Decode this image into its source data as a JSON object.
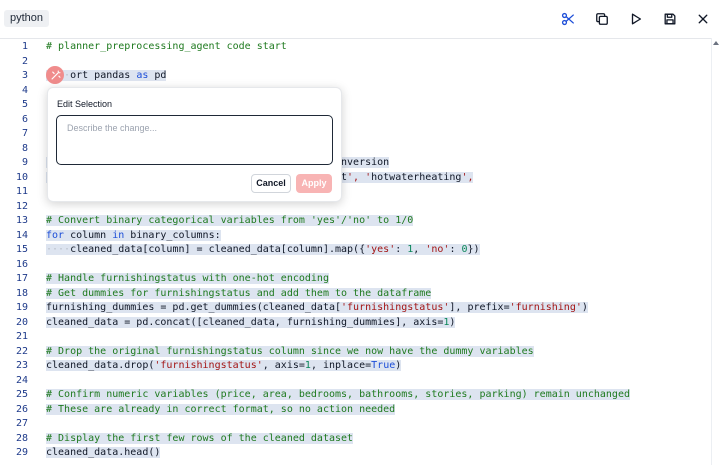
{
  "toolbar": {
    "language": "python",
    "icons": [
      "scissors-icon",
      "copy-icon",
      "play-icon",
      "save-icon",
      "close-icon"
    ]
  },
  "colors": {
    "comment": "#1f7a1f",
    "keyword": "#1d4ed8",
    "string": "#a31515",
    "number": "#098658",
    "line_number": "#1e3a8a",
    "selection": "#dde4f0",
    "ai_button": "#f08c8c",
    "apply_button": "#f8b4b4"
  },
  "editor": {
    "lines": [
      {
        "n": "1",
        "text": "# planner_preprocessing_agent code start"
      },
      {
        "n": "2",
        "text": ""
      },
      {
        "n": "3",
        "text": "    ort pandas as pd"
      },
      {
        "n": "4",
        "text": ""
      },
      {
        "n": "5",
        "text": ""
      },
      {
        "n": "6",
        "text": ""
      },
      {
        "n": "7",
        "text": ""
      },
      {
        "n": "8",
        "text": ""
      },
      {
        "n": "9",
        "text": "                                                onversion"
      },
      {
        "n": "10",
        "text": "                                                nt', 'hotwaterheating',"
      },
      {
        "n": "11",
        "text": ""
      },
      {
        "n": "12",
        "text": ""
      },
      {
        "n": "13",
        "text": "# Convert binary categorical variables from 'yes'/'no' to 1/0"
      },
      {
        "n": "14",
        "text": "for column in binary_columns:"
      },
      {
        "n": "15",
        "text": "    cleaned_data[column] = cleaned_data[column].map({'yes': 1, 'no': 0})"
      },
      {
        "n": "16",
        "text": ""
      },
      {
        "n": "17",
        "text": "# Handle furnishingstatus with one-hot encoding"
      },
      {
        "n": "18",
        "text": "# Get dummies for furnishingstatus and add them to the dataframe"
      },
      {
        "n": "19",
        "text": "furnishing_dummies = pd.get_dummies(cleaned_data['furnishingstatus'], prefix='furnishing')"
      },
      {
        "n": "20",
        "text": "cleaned_data = pd.concat([cleaned_data, furnishing_dummies], axis=1)"
      },
      {
        "n": "21",
        "text": ""
      },
      {
        "n": "22",
        "text": "# Drop the original furnishingstatus column since we now have the dummy variables"
      },
      {
        "n": "23",
        "text": "cleaned_data.drop('furnishingstatus', axis=1, inplace=True)"
      },
      {
        "n": "24",
        "text": ""
      },
      {
        "n": "25",
        "text": "# Confirm numeric variables (price, area, bedrooms, bathrooms, stories, parking) remain unchanged"
      },
      {
        "n": "26",
        "text": "# These are already in correct format, so no action needed"
      },
      {
        "n": "27",
        "text": ""
      },
      {
        "n": "28",
        "text": "# Display the first few rows of the cleaned dataset"
      },
      {
        "n": "29",
        "text": "cleaned_data.head()"
      }
    ]
  },
  "edit_popup": {
    "title": "Edit Selection",
    "placeholder": "Describe the change...",
    "value": "",
    "cancel_label": "Cancel",
    "apply_label": "Apply",
    "apply_enabled": false
  }
}
